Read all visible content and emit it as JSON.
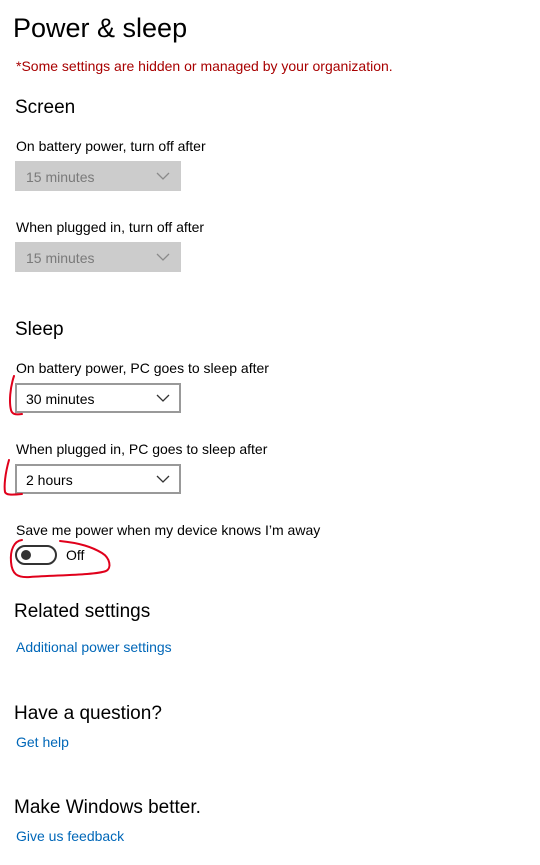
{
  "page": {
    "title": "Power & sleep",
    "notice": "*Some settings are hidden or managed by your organization."
  },
  "screen": {
    "heading": "Screen",
    "battery": {
      "label": "On battery power, turn off after",
      "value": "15 minutes",
      "disabled": true
    },
    "plugged": {
      "label": "When plugged in, turn off after",
      "value": "15 minutes",
      "disabled": true
    }
  },
  "sleep": {
    "heading": "Sleep",
    "battery": {
      "label": "On battery power, PC goes to sleep after",
      "value": "30 minutes"
    },
    "plugged": {
      "label": "When plugged in, PC goes to sleep after",
      "value": "2 hours"
    }
  },
  "away_power": {
    "label": "Save me power when my device knows I’m away",
    "state": "Off",
    "on": false
  },
  "related": {
    "heading": "Related settings",
    "link": "Additional power settings"
  },
  "question": {
    "heading": "Have a question?",
    "link": "Get help"
  },
  "feedback": {
    "heading": "Make Windows better.",
    "link": "Give us feedback"
  },
  "colors": {
    "notice": "#a80000",
    "link": "#0067b8",
    "annotation": "#e0001b",
    "disabled_fill": "#cccccc"
  }
}
